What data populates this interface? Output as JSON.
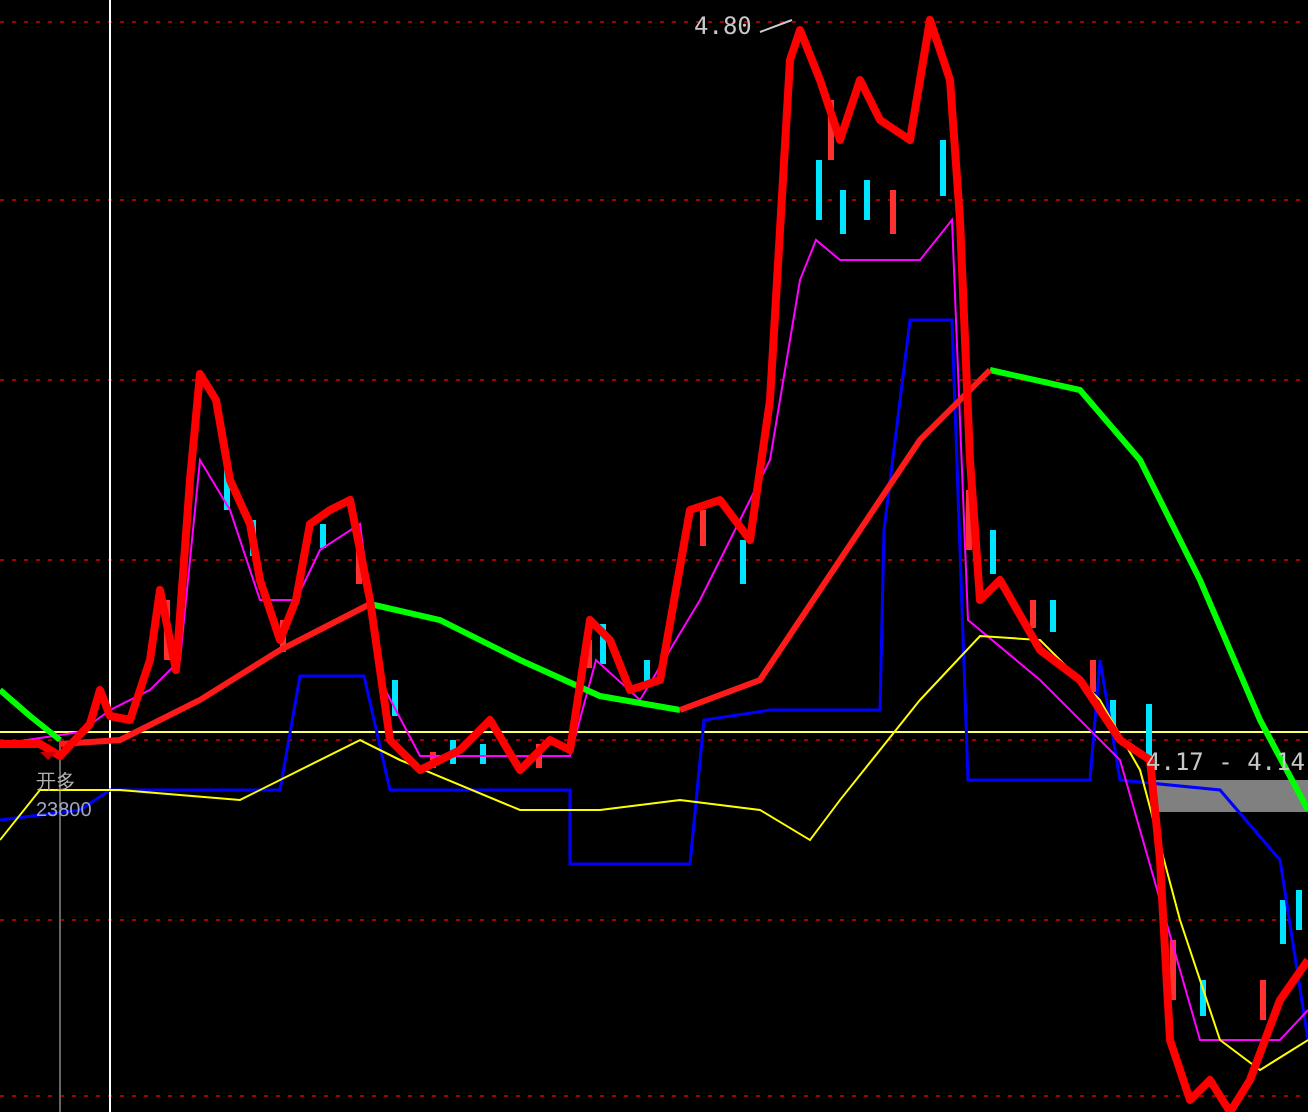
{
  "chart": {
    "high_label": "4.80",
    "range_label": "4.17 - 4.14",
    "signal": {
      "label": "开多",
      "volume": "23800"
    }
  }
}
